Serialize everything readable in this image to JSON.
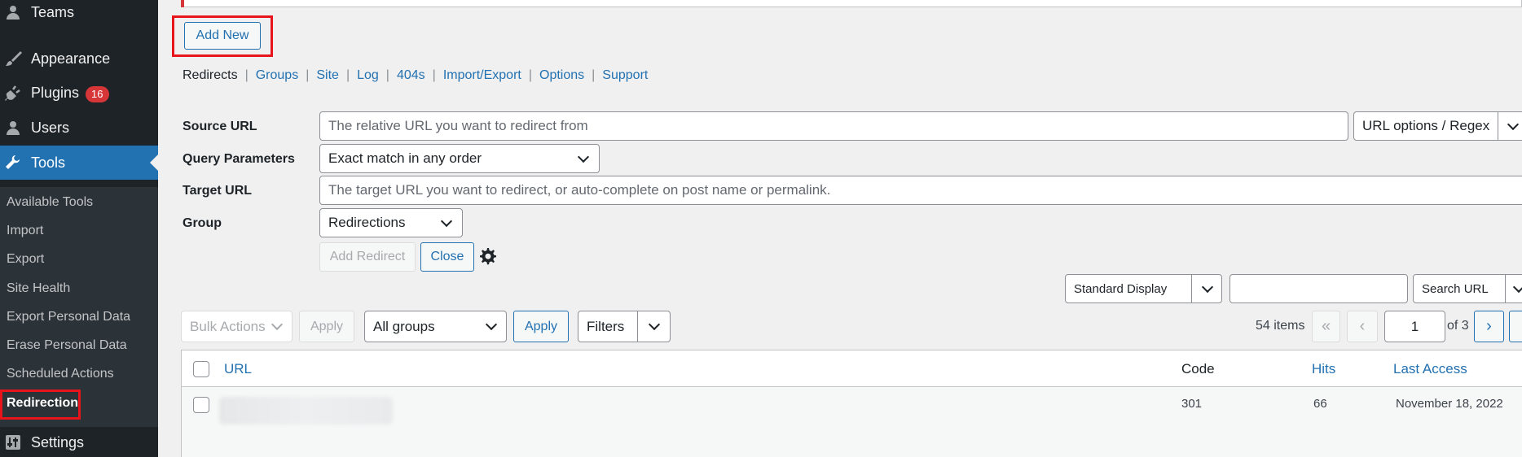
{
  "sidebar": {
    "menu": {
      "teams": "Teams",
      "appearance": "Appearance",
      "plugins": "Plugins",
      "plugins_badge": "16",
      "users": "Users",
      "tools": "Tools",
      "settings": "Settings"
    },
    "submenu": {
      "available_tools": "Available Tools",
      "import": "Import",
      "export": "Export",
      "site_health": "Site Health",
      "export_personal_data": "Export Personal Data",
      "erase_personal_data": "Erase Personal Data",
      "scheduled_actions": "Scheduled Actions",
      "redirection": "Redirection"
    }
  },
  "header": {
    "add_new": "Add New"
  },
  "subnav": {
    "redirects": "Redirects",
    "groups": "Groups",
    "site": "Site",
    "log": "Log",
    "404s": "404s",
    "import_export": "Import/Export",
    "options": "Options",
    "support": "Support"
  },
  "form": {
    "source_url_label": "Source URL",
    "source_url_placeholder": "The relative URL you want to redirect from",
    "url_options": "URL options / Regex",
    "query_params_label": "Query Parameters",
    "query_params_value": "Exact match in any order",
    "target_url_label": "Target URL",
    "target_url_placeholder": "The target URL you want to redirect, or auto-complete on post name or permalink.",
    "group_label": "Group",
    "group_value": "Redirections",
    "add_redirect": "Add Redirect",
    "close": "Close"
  },
  "search": {
    "display": "Standard Display",
    "search_url": "Search URL"
  },
  "tablenav": {
    "bulk_actions": "Bulk Actions",
    "apply1": "Apply",
    "all_groups": "All groups",
    "apply2": "Apply",
    "filters": "Filters",
    "items_count": "54 items",
    "first": "«",
    "prev": "‹",
    "page": "1",
    "of_pages": "of 3",
    "next": "›"
  },
  "table": {
    "columns": {
      "url": "URL",
      "code": "Code",
      "hits": "Hits",
      "last_access": "Last Access"
    },
    "rows": [
      {
        "code": "301",
        "hits": "66",
        "last_access": "November 18, 2022"
      }
    ]
  },
  "colors": {
    "accent": "#2271b1",
    "sidebar": "#1d2327",
    "highlight": "#e8141c",
    "badge": "#d63638"
  }
}
